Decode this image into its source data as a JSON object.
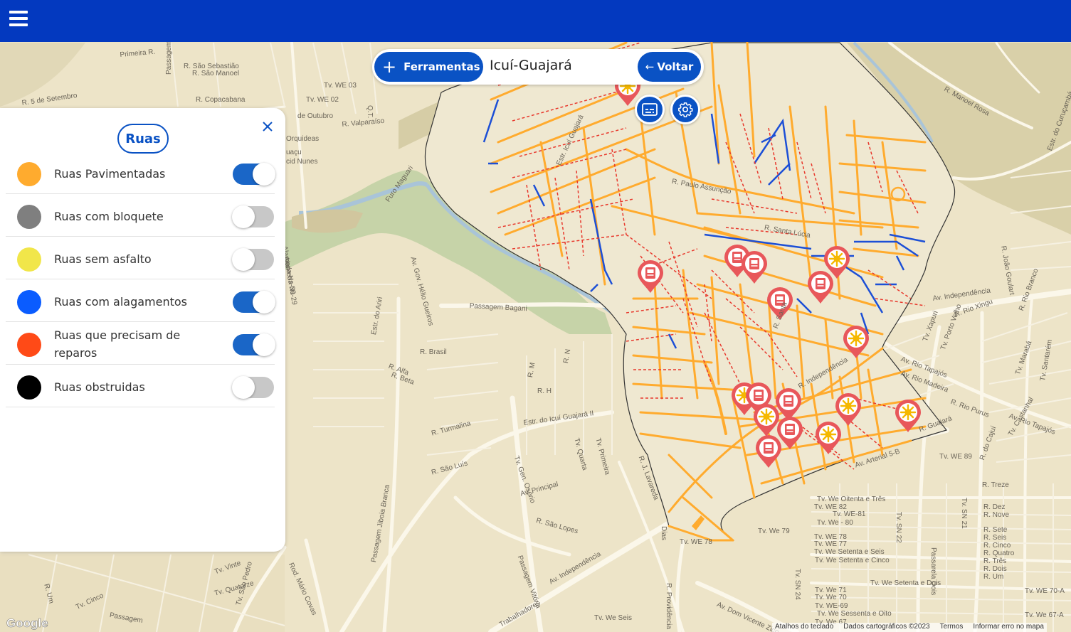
{
  "header": {
    "menu_icon": "hamburger-menu-icon",
    "brand_color": "#0339bf"
  },
  "search": {
    "tools_label": "Ferramentas",
    "place_name": "Icuí-Guajará",
    "back_label": "Voltar"
  },
  "map_controls": {
    "legend_icon": "subtitles-icon",
    "settings_icon": "gear-icon"
  },
  "panel": {
    "title": "Ruas",
    "close_icon": "close-icon",
    "layers": [
      {
        "label": "Ruas Pavimentadas",
        "color": "#ffab2e",
        "enabled": true
      },
      {
        "label": "Ruas com bloquete",
        "color": "#7f7f7f",
        "enabled": false
      },
      {
        "label": "Ruas sem asfalto",
        "color": "#f1e64a",
        "enabled": false
      },
      {
        "label": "Ruas com alagamentos",
        "color": "#0a5cff",
        "enabled": true
      },
      {
        "label": "Ruas que precisam de reparos",
        "color": "#ff4a17",
        "enabled": true
      },
      {
        "label": "Ruas obstruidas",
        "color": "#000000",
        "enabled": false
      }
    ]
  },
  "map_labels": [
    "Primeira R.",
    "R. São Sebastião",
    "R. São Manoel",
    "Passagem Q.ta Linha",
    "R. Copacabana",
    "R. 5 de Setembro",
    "Tv. WE 03",
    "Tv. WE 02",
    "cid Nunes",
    "Orquideas",
    "uaçu",
    "R. Valparaíso",
    "Q.T.",
    "de Outubro",
    "Furo Maguari",
    "Alameda Ns-30",
    "Alameda Ns-29",
    "Av. Gov. Hélio Gueiros",
    "Passagem Bagani",
    "Estr. do Ariri",
    "R. Brasil",
    "R. Alfa",
    "R. Beta",
    "R. M",
    "R. H",
    "R. N",
    "Estr. do Icuí Guajará II",
    "R. Turmalina",
    "R. São Luís",
    "Tv. Gen. Osório",
    "Tv. Quarta",
    "Tv. Primeira",
    "R. J. Lavareda",
    "Av. Principal",
    "R. São Lopes",
    "Passagem Jiboia Branca",
    "Rod. Mário Covas",
    "Passagem Vitória",
    "Av. Independência",
    "Trabalhadores",
    "R. Providência",
    "Av. Dom Vicente Zico",
    "Tv. We Seis",
    "Tv. WE 78",
    "Tv. We 79",
    "Av. Arterial 5-B",
    "Tv. WE 89",
    "Tv. We Oitenta e Três",
    "Tv. WE 82",
    "Tv. WE-81",
    "Tv. We - 80",
    "Tv. WE 78",
    "Tv. WE 77",
    "Tv. We Setenta e Seis",
    "Tv. We Setenta e Cinco",
    "Tv. We Setenta e Dois",
    "Tv. We 71",
    "Tv. We 70",
    "Tv. WE-69",
    "Tv. We Sessenta e Oito",
    "Tv. We 67",
    "Tv. SN 22",
    "Tv. SN 21",
    "Tv. SN 24",
    "Passarela Dois",
    "R. Treze",
    "R. Dez",
    "R. Nove",
    "R. Sete",
    "R. Seis",
    "R. Cinco",
    "R. Quatro",
    "R. Três",
    "R. Dois",
    "R. Um",
    "Tv. WE 70-A",
    "Tv. We 67-A",
    "Av. Independência",
    "Av. Rio Tapajós",
    "Av. Rio Madeira",
    "R. Rio Purus",
    "Tv. Porto Velho",
    "Tv. Xapuri",
    "R. Rio Xingu",
    "R. Rio Branco",
    "R. João Goulart",
    "Tv. Marabá",
    "Tv. Santarém",
    "R. do Cajuí",
    "Tv. Castanhal",
    "Av. Rio Tapajós",
    "Estr. do Curuçambá",
    "R. Manoel Rosa",
    "Estr. Icuí Guajará",
    "R. Paulo Assunção",
    "R. Santa Lúcia",
    "R. Santa",
    "R. Independência",
    "R. Guajará",
    "Tv. Vinte",
    "Tv. Quatorze",
    "Passagem",
    "Tv. Cinco",
    "Tv. São Pedro",
    "R. Um",
    "Dias"
  ],
  "attribution": {
    "google_label": "Google",
    "shortcuts": "Atalhos do teclado",
    "data": "Dados cartográficos ©2023",
    "terms": "Termos",
    "report": "Informar erro no mapa"
  }
}
